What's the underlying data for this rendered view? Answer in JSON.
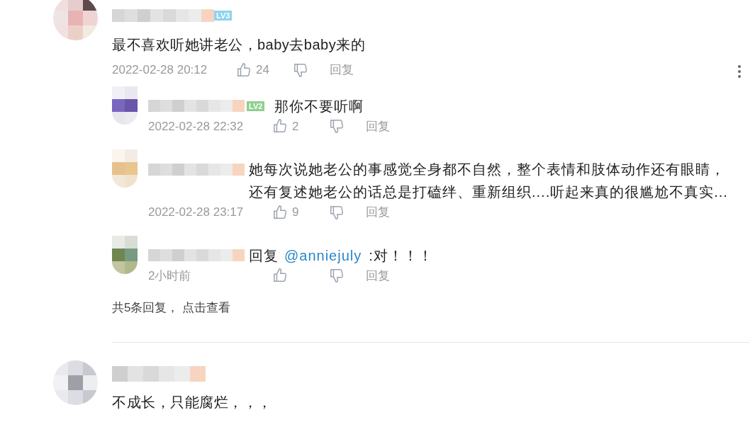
{
  "comments": [
    {
      "badge": "LV3",
      "text": "最不喜欢听她讲老公，baby去baby来的",
      "time": "2022-02-28 20:12",
      "likes": "24",
      "reply_label": "回复",
      "replies": [
        {
          "badge": "LV2",
          "text": "那你不要听啊",
          "time": "2022-02-28 22:32",
          "likes": "2",
          "reply_label": "回复"
        },
        {
          "text": "她每次说她老公的事感觉全身都不自然，整个表情和肢体动作还有眼睛，还有复述她老公的话总是打磕绊、重新组织....听起来真的很尴尬不真实...",
          "time": "2022-02-28 23:17",
          "likes": "9",
          "reply_label": "回复"
        },
        {
          "reply_prefix": "回复",
          "mention": "@anniejuly",
          "text": ":对！！！",
          "time": "2小时前",
          "reply_label": "回复"
        }
      ],
      "more_replies": "共5条回复， 点击查看"
    },
    {
      "text": "不成长，只能腐烂，，，"
    }
  ]
}
